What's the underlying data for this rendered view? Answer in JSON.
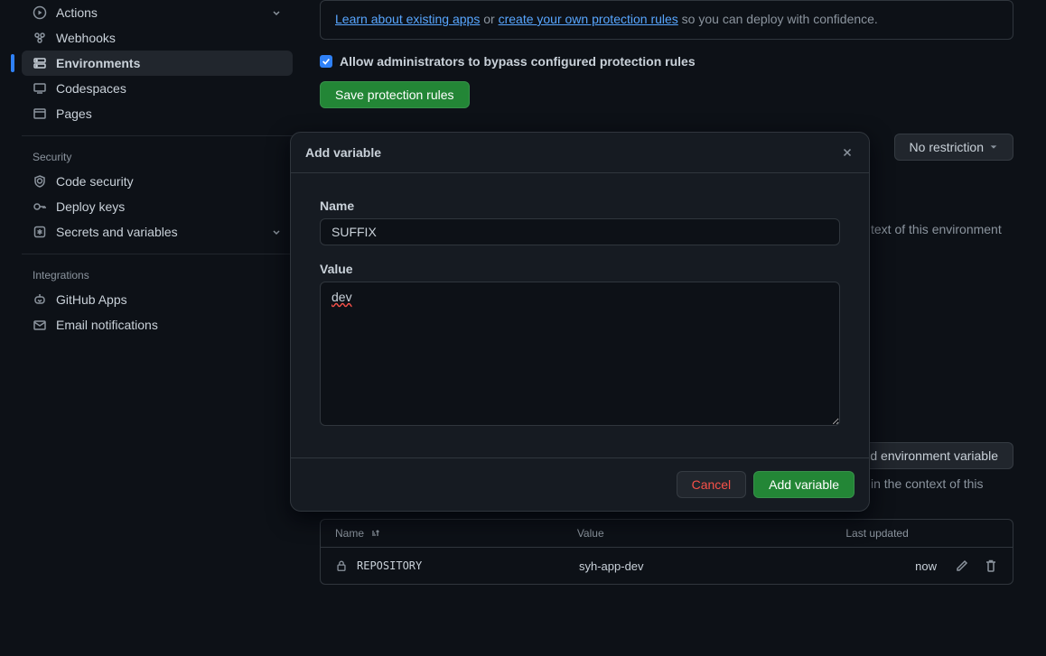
{
  "sidebar": {
    "code": {
      "actions": "Actions",
      "webhooks": "Webhooks",
      "environments": "Environments",
      "codespaces": "Codespaces",
      "pages": "Pages"
    },
    "security_heading": "Security",
    "security": {
      "code_security": "Code security",
      "deploy_keys": "Deploy keys",
      "secrets": "Secrets and variables"
    },
    "integrations_heading": "Integrations",
    "integrations": {
      "github_apps": "GitHub Apps",
      "email": "Email notifications"
    }
  },
  "info": {
    "learn_link": "Learn about existing apps",
    "or": " or ",
    "create_link": "create your own protection rules",
    "tail": " so you can deploy with confidence."
  },
  "allow_admin_label": "Allow administrators to bypass configured protection rules",
  "save_rules_btn": "Save protection rules",
  "no_restriction_btn": "No restriction",
  "env_context_text_1": "text of this environment",
  "add_env_var_btn": "d environment variable",
  "env_context_text_2": "in the context of this",
  "table": {
    "header": {
      "name": "Name",
      "value": "Value",
      "updated": "Last updated"
    },
    "row": {
      "name": "REPOSITORY",
      "value": "syh-app-dev",
      "updated": "now"
    }
  },
  "modal": {
    "title": "Add variable",
    "name_label": "Name",
    "name_value": "SUFFIX",
    "value_label": "Value",
    "value_value": "dev",
    "cancel": "Cancel",
    "submit": "Add variable"
  }
}
